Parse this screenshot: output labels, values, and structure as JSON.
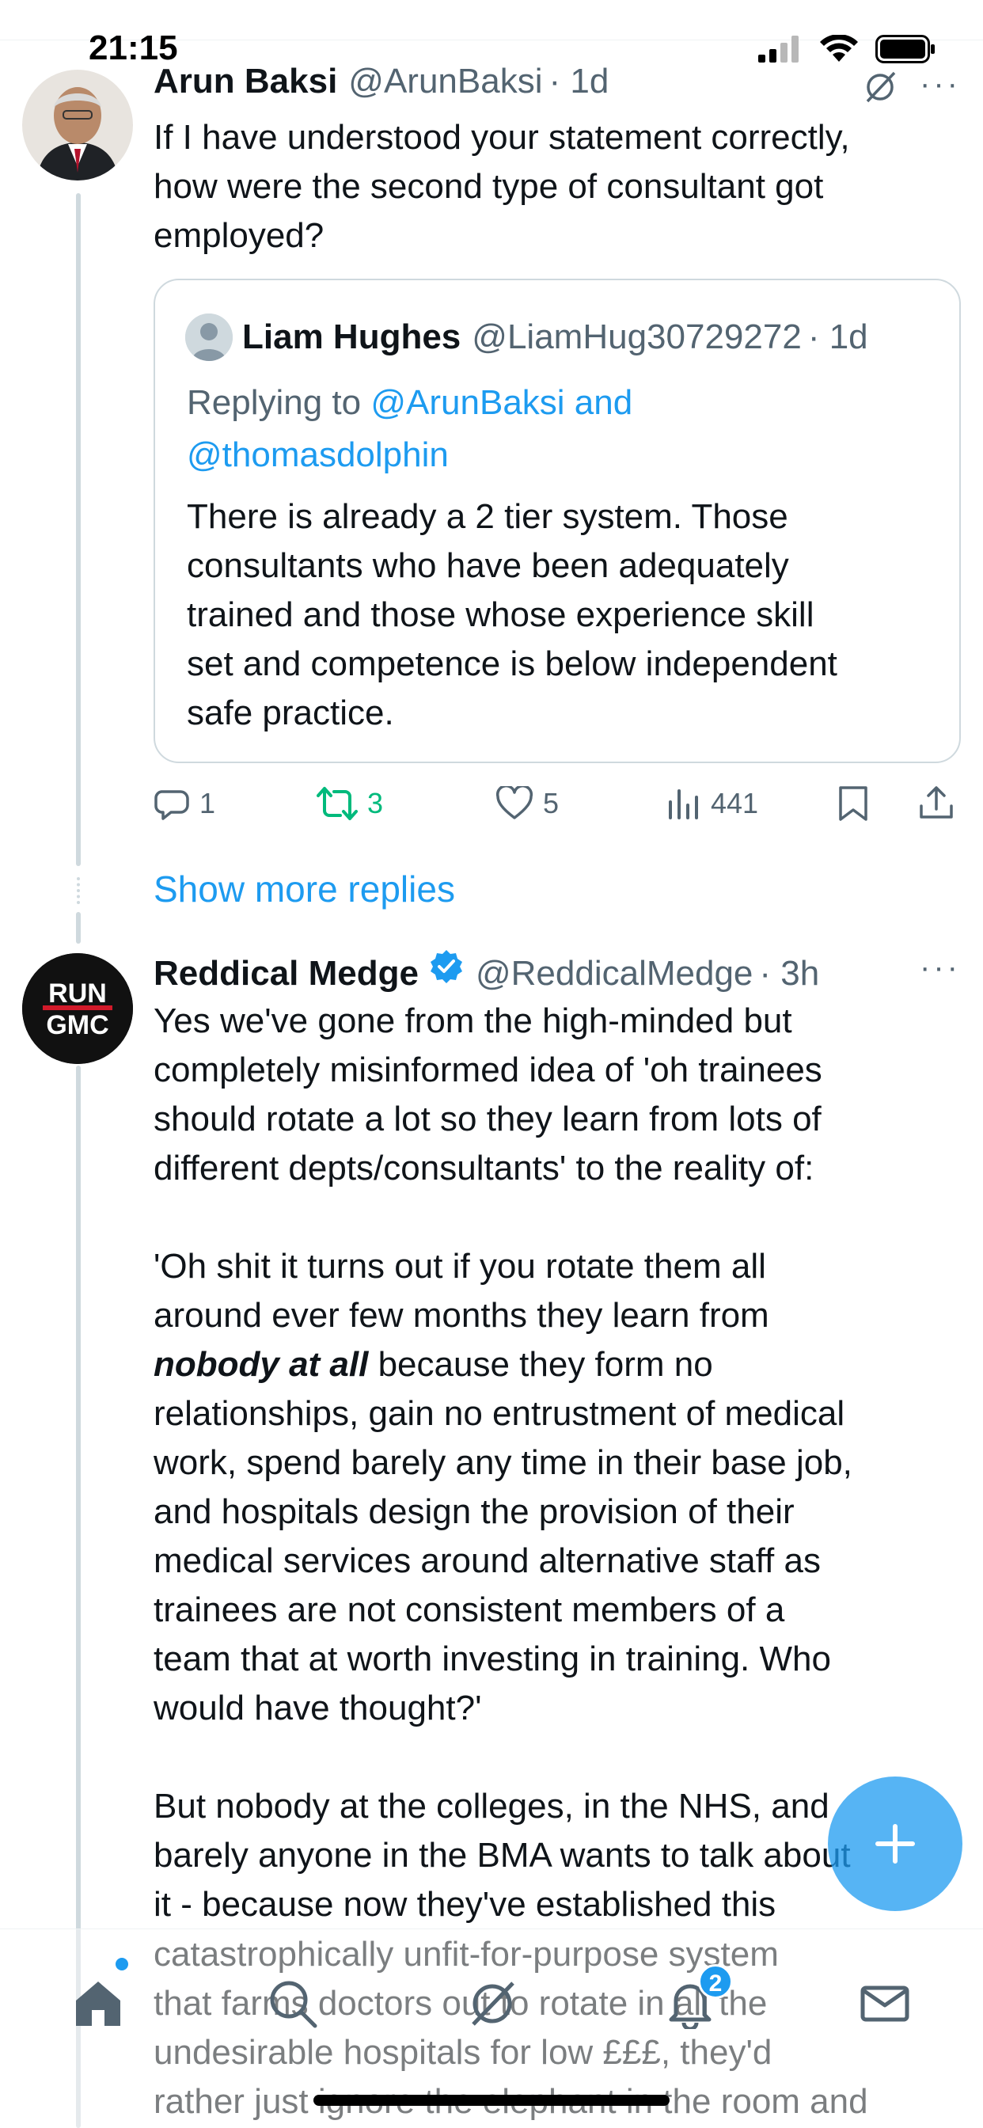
{
  "status_bar": {
    "time": "21:15"
  },
  "tweet_1": {
    "name": "Arun Baksi",
    "handle": "@ArunBaksi",
    "time": "· 1d",
    "text_lines": [
      "If I have understood your statement correctly,",
      "how were the second type of consultant got",
      "employed?"
    ],
    "quote": {
      "name": "Liam Hughes",
      "handle": "@LiamHug30729272",
      "time": "· 1d",
      "replying_prefix": "Replying to ",
      "replying_to_1": "@ArunBaksi and",
      "replying_to_2": "@thomasdolphin",
      "text_lines": [
        "There is already a 2 tier system. Those",
        "consultants who have been adequately",
        "trained and those whose experience skill",
        "set and competence is below independent",
        "safe practice."
      ]
    },
    "actions": {
      "replies": "1",
      "reposts": "3",
      "likes": "5",
      "views": "441"
    }
  },
  "show_more_replies": "Show more replies",
  "tweet_2": {
    "avatar_text_1": "RUN",
    "avatar_text_2": "GMC",
    "name": "Reddical Medge",
    "handle": "@ReddicalMedge",
    "time": "· 3h",
    "para_1_lines": [
      "Yes we've gone from the high-minded but",
      "completely misinformed idea of 'oh trainees",
      "should rotate a lot so they learn from lots of",
      "different depts/consultants' to the reality of:"
    ],
    "para_2_line_1": "'Oh shit it turns out if you rotate them all",
    "para_2_line_2": "around ever few months they learn from",
    "para_2_emph": "nobody at all",
    "para_2_line_3_rest": " because they form no",
    "para_2_lines_rest": [
      "relationships, gain no entrustment of medical",
      "work, spend barely any time in their base job,",
      "and hospitals design the provision of their",
      "medical services around alternative staff as",
      "trainees are not consistent members of a",
      "team that at worth investing in training. Who",
      "would have thought?'"
    ],
    "para_3_lines": [
      "But nobody at the colleges, in the NHS, and",
      "barely anyone in the BMA wants to talk about",
      "it - because now they've established this"
    ],
    "para_3_faded_lines": [
      "catastrophically unfit-for-purpose system",
      "that farms doctors out to rotate in all the",
      "undesirable hospitals for low £££, they'd",
      "rather just ignore the elephant in the room and"
    ]
  },
  "tabbar": {
    "notifications_badge": "2"
  },
  "colors": {
    "accent": "#1d9bf0",
    "repost_green": "#00ba7c",
    "secondary_text": "#536471"
  }
}
